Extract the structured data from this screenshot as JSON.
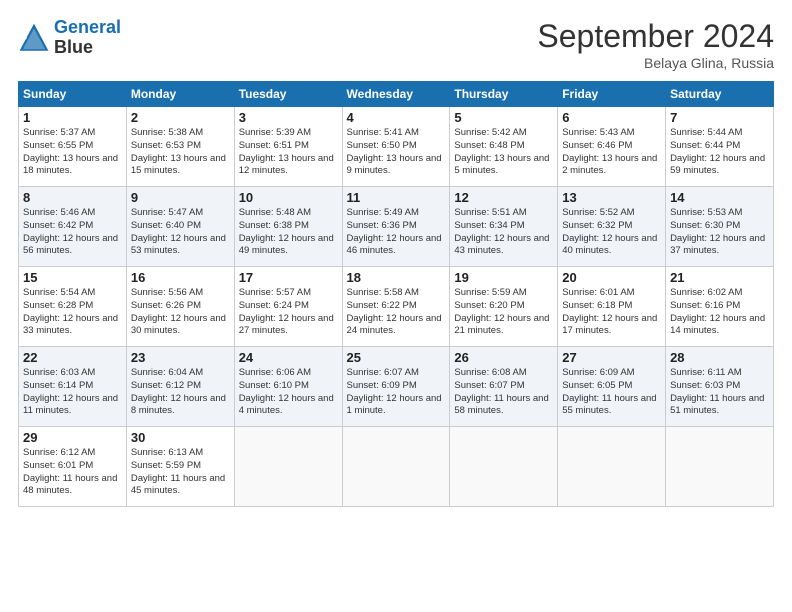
{
  "header": {
    "logo_line1": "General",
    "logo_line2": "Blue",
    "month_title": "September 2024",
    "location": "Belaya Glina, Russia"
  },
  "days_of_week": [
    "Sunday",
    "Monday",
    "Tuesday",
    "Wednesday",
    "Thursday",
    "Friday",
    "Saturday"
  ],
  "weeks": [
    [
      {
        "day": "1",
        "sunrise": "5:37 AM",
        "sunset": "6:55 PM",
        "daylight": "13 hours and 18 minutes."
      },
      {
        "day": "2",
        "sunrise": "5:38 AM",
        "sunset": "6:53 PM",
        "daylight": "13 hours and 15 minutes."
      },
      {
        "day": "3",
        "sunrise": "5:39 AM",
        "sunset": "6:51 PM",
        "daylight": "13 hours and 12 minutes."
      },
      {
        "day": "4",
        "sunrise": "5:41 AM",
        "sunset": "6:50 PM",
        "daylight": "13 hours and 9 minutes."
      },
      {
        "day": "5",
        "sunrise": "5:42 AM",
        "sunset": "6:48 PM",
        "daylight": "13 hours and 5 minutes."
      },
      {
        "day": "6",
        "sunrise": "5:43 AM",
        "sunset": "6:46 PM",
        "daylight": "13 hours and 2 minutes."
      },
      {
        "day": "7",
        "sunrise": "5:44 AM",
        "sunset": "6:44 PM",
        "daylight": "12 hours and 59 minutes."
      }
    ],
    [
      {
        "day": "8",
        "sunrise": "5:46 AM",
        "sunset": "6:42 PM",
        "daylight": "12 hours and 56 minutes."
      },
      {
        "day": "9",
        "sunrise": "5:47 AM",
        "sunset": "6:40 PM",
        "daylight": "12 hours and 53 minutes."
      },
      {
        "day": "10",
        "sunrise": "5:48 AM",
        "sunset": "6:38 PM",
        "daylight": "12 hours and 49 minutes."
      },
      {
        "day": "11",
        "sunrise": "5:49 AM",
        "sunset": "6:36 PM",
        "daylight": "12 hours and 46 minutes."
      },
      {
        "day": "12",
        "sunrise": "5:51 AM",
        "sunset": "6:34 PM",
        "daylight": "12 hours and 43 minutes."
      },
      {
        "day": "13",
        "sunrise": "5:52 AM",
        "sunset": "6:32 PM",
        "daylight": "12 hours and 40 minutes."
      },
      {
        "day": "14",
        "sunrise": "5:53 AM",
        "sunset": "6:30 PM",
        "daylight": "12 hours and 37 minutes."
      }
    ],
    [
      {
        "day": "15",
        "sunrise": "5:54 AM",
        "sunset": "6:28 PM",
        "daylight": "12 hours and 33 minutes."
      },
      {
        "day": "16",
        "sunrise": "5:56 AM",
        "sunset": "6:26 PM",
        "daylight": "12 hours and 30 minutes."
      },
      {
        "day": "17",
        "sunrise": "5:57 AM",
        "sunset": "6:24 PM",
        "daylight": "12 hours and 27 minutes."
      },
      {
        "day": "18",
        "sunrise": "5:58 AM",
        "sunset": "6:22 PM",
        "daylight": "12 hours and 24 minutes."
      },
      {
        "day": "19",
        "sunrise": "5:59 AM",
        "sunset": "6:20 PM",
        "daylight": "12 hours and 21 minutes."
      },
      {
        "day": "20",
        "sunrise": "6:01 AM",
        "sunset": "6:18 PM",
        "daylight": "12 hours and 17 minutes."
      },
      {
        "day": "21",
        "sunrise": "6:02 AM",
        "sunset": "6:16 PM",
        "daylight": "12 hours and 14 minutes."
      }
    ],
    [
      {
        "day": "22",
        "sunrise": "6:03 AM",
        "sunset": "6:14 PM",
        "daylight": "12 hours and 11 minutes."
      },
      {
        "day": "23",
        "sunrise": "6:04 AM",
        "sunset": "6:12 PM",
        "daylight": "12 hours and 8 minutes."
      },
      {
        "day": "24",
        "sunrise": "6:06 AM",
        "sunset": "6:10 PM",
        "daylight": "12 hours and 4 minutes."
      },
      {
        "day": "25",
        "sunrise": "6:07 AM",
        "sunset": "6:09 PM",
        "daylight": "12 hours and 1 minute."
      },
      {
        "day": "26",
        "sunrise": "6:08 AM",
        "sunset": "6:07 PM",
        "daylight": "11 hours and 58 minutes."
      },
      {
        "day": "27",
        "sunrise": "6:09 AM",
        "sunset": "6:05 PM",
        "daylight": "11 hours and 55 minutes."
      },
      {
        "day": "28",
        "sunrise": "6:11 AM",
        "sunset": "6:03 PM",
        "daylight": "11 hours and 51 minutes."
      }
    ],
    [
      {
        "day": "29",
        "sunrise": "6:12 AM",
        "sunset": "6:01 PM",
        "daylight": "11 hours and 48 minutes."
      },
      {
        "day": "30",
        "sunrise": "6:13 AM",
        "sunset": "5:59 PM",
        "daylight": "11 hours and 45 minutes."
      },
      null,
      null,
      null,
      null,
      null
    ]
  ]
}
